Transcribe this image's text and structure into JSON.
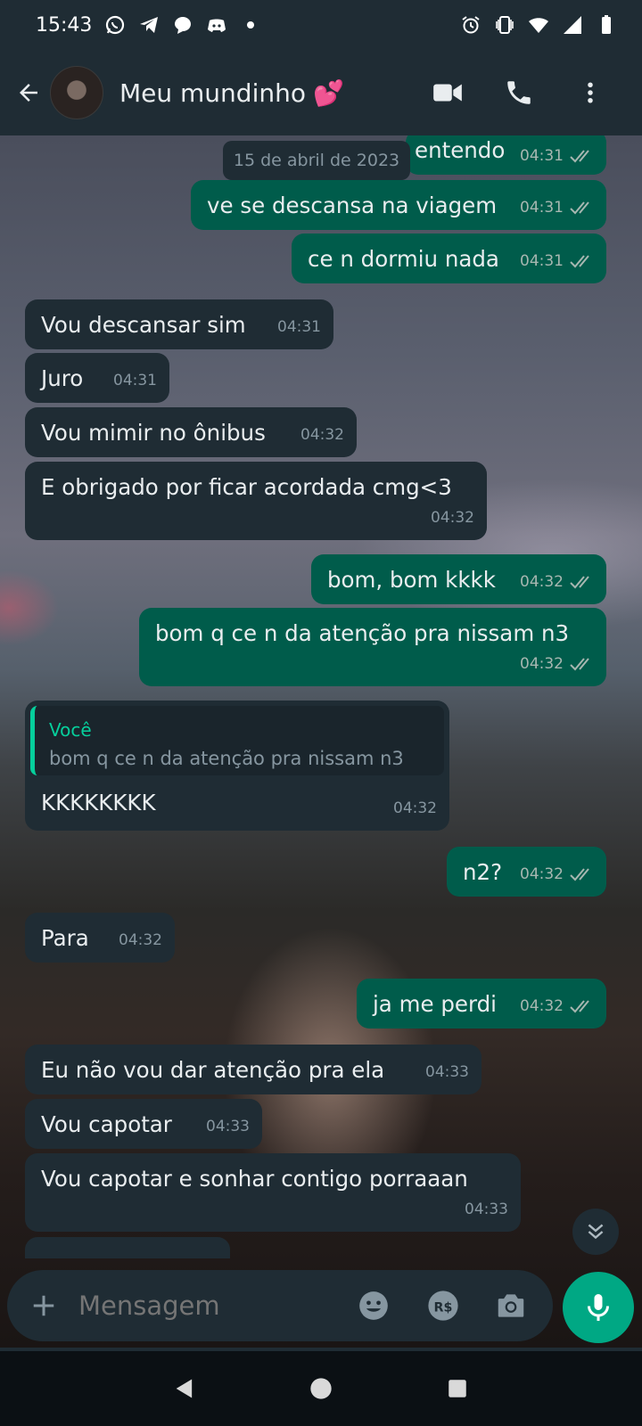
{
  "status_bar": {
    "time": "15:43",
    "left_icons": [
      "whatsapp-icon",
      "telegram-icon",
      "chat-bubble-icon",
      "discord-icon",
      "dot-icon"
    ],
    "right_icons": [
      "alarm-icon",
      "vibrate-icon",
      "wifi-icon",
      "signal-icon",
      "battery-icon"
    ]
  },
  "header": {
    "title": "Meu mundinho",
    "title_emoji": "💕",
    "actions": [
      "video-call-icon",
      "voice-call-icon",
      "more-options-icon"
    ]
  },
  "date_chip": "15 de abril de 2023",
  "messages": [
    {
      "dir": "out",
      "text": "entendo",
      "time": "04:31",
      "read": true
    },
    {
      "dir": "out",
      "text": "ve se descansa na viagem",
      "time": "04:31",
      "read": true
    },
    {
      "dir": "out",
      "text": "ce n dormiu nada",
      "time": "04:31",
      "read": true
    },
    {
      "dir": "in",
      "text": "Vou descansar sim",
      "time": "04:31"
    },
    {
      "dir": "in",
      "text": "Juro",
      "time": "04:31"
    },
    {
      "dir": "in",
      "text": "Vou mimir no ônibus",
      "time": "04:32"
    },
    {
      "dir": "in",
      "text": "E obrigado por ficar acordada cmg<3",
      "time": "04:32"
    },
    {
      "dir": "out",
      "text": "bom, bom kkkk",
      "time": "04:32",
      "read": true
    },
    {
      "dir": "out",
      "text": "bom q ce n da atenção pra nissam n3",
      "time": "04:32",
      "read": true
    },
    {
      "dir": "in",
      "text": "KKKKKKKK",
      "time": "04:32",
      "quote": {
        "author": "Você",
        "text": "bom q ce n da atenção pra nissam n3"
      }
    },
    {
      "dir": "out",
      "text": "n2?",
      "time": "04:32",
      "read": true
    },
    {
      "dir": "in",
      "text": "Para",
      "time": "04:32"
    },
    {
      "dir": "out",
      "text": "ja me perdi",
      "time": "04:32",
      "read": true
    },
    {
      "dir": "in",
      "text": "Eu não vou dar atenção pra ela",
      "time": "04:33"
    },
    {
      "dir": "in",
      "text": "Vou capotar",
      "time": "04:33"
    },
    {
      "dir": "in",
      "text": "Vou capotar e sonhar contigo porraaan",
      "time": "04:33"
    }
  ],
  "input_bar": {
    "placeholder": "Mensagem",
    "icons": [
      "plus-icon",
      "emoji-icon",
      "payment-icon",
      "camera-icon",
      "mic-icon"
    ]
  },
  "colors": {
    "outgoing_bubble": "#005c4b",
    "incoming_bubble": "#1f2c34",
    "accent": "#00a884",
    "header_bg": "#1f2c34"
  }
}
